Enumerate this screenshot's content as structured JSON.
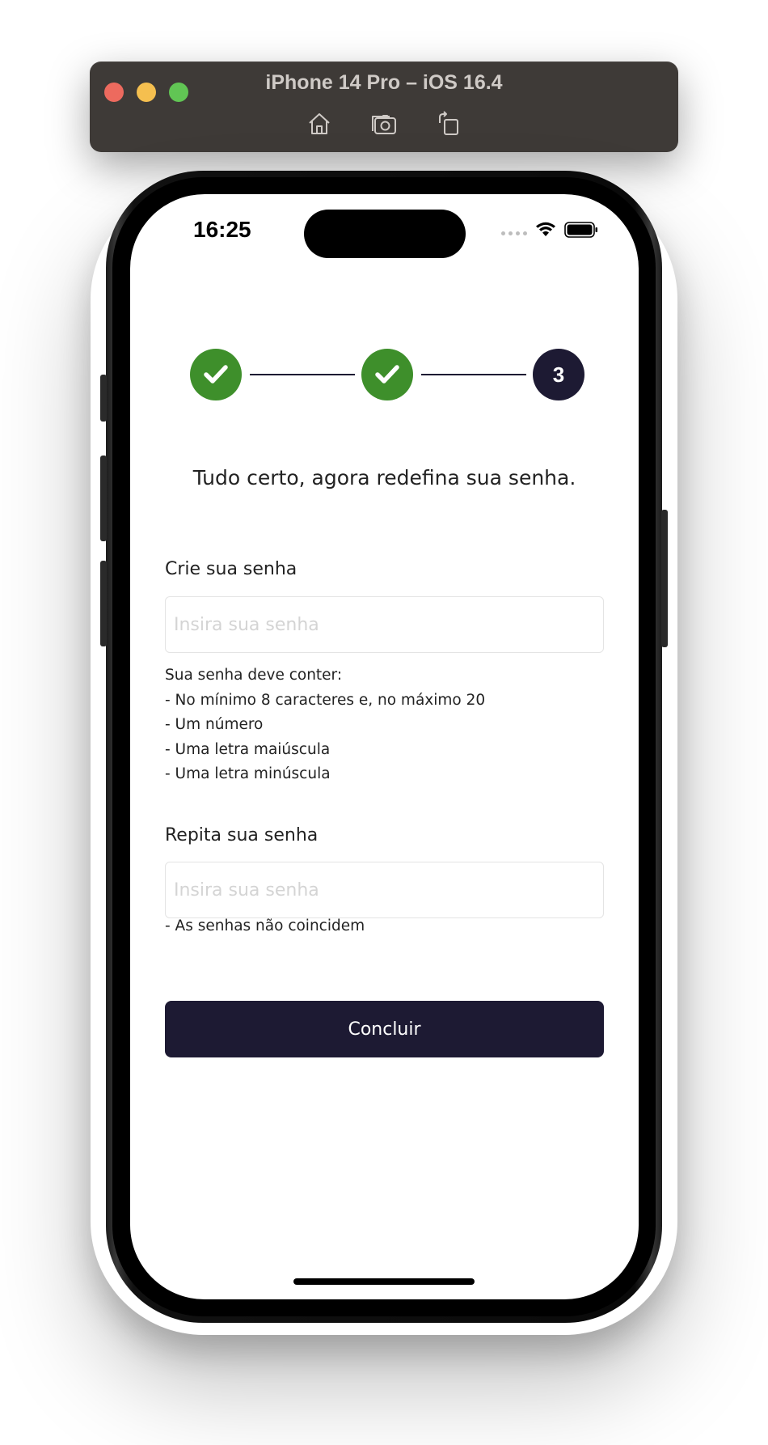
{
  "simulator": {
    "title": "iPhone 14 Pro – iOS 16.4",
    "toolbar_icons": [
      "home-icon",
      "screenshot-icon",
      "rotate-icon"
    ]
  },
  "status_bar": {
    "time": "16:25",
    "icons": [
      "cellular-icon",
      "wifi-icon",
      "battery-icon"
    ]
  },
  "stepper": {
    "steps": [
      {
        "state": "done",
        "icon": "check-icon"
      },
      {
        "state": "done",
        "icon": "check-icon"
      },
      {
        "state": "current",
        "label": "3"
      }
    ],
    "done_color": "#3e8f2b",
    "current_color": "#1d1a33"
  },
  "form": {
    "headline": "Tudo certo, agora redefina sua senha.",
    "password": {
      "label": "Crie sua senha",
      "placeholder": "Insira sua senha",
      "value": ""
    },
    "rules": {
      "title": "Sua senha deve conter:",
      "items": [
        "- No mínimo 8 caracteres e, no máximo 20",
        "- Um número",
        "- Uma letra maiúscula",
        "- Uma letra minúscula"
      ]
    },
    "confirm": {
      "label": "Repita sua senha",
      "placeholder": "Insira sua senha",
      "value": "",
      "error": "- As senhas não coincidem"
    },
    "submit_label": "Concluir"
  },
  "colors": {
    "primary": "#1d1a33",
    "success": "#3e8f2b"
  }
}
